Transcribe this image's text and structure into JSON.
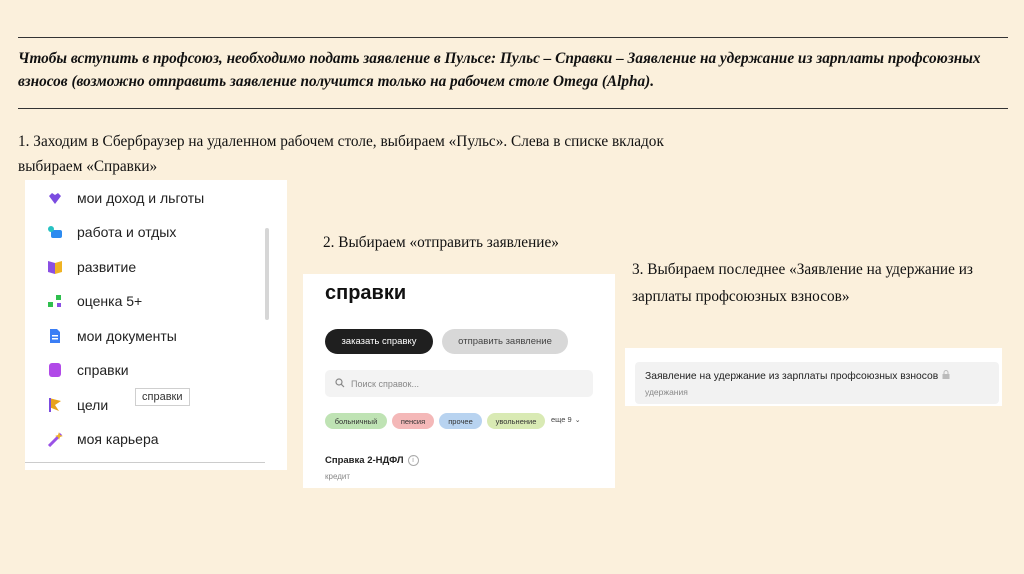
{
  "intro": "Чтобы вступить в профсоюз, необходимо подать заявление в Пульсе: Пульс – Справки – Заявление на удержание из зарплаты профсоюзных взносов (возможно отправить заявление получится только на рабочем столе Omega (Alpha).",
  "steps": {
    "step1": "1. Заходим в Сбербраузер на удаленном рабочем столе, выбираем «Пульс». Слева в списке вкладок выбираем «Справки»",
    "step2": "2. Выбираем «отправить заявление»",
    "step3": "3. Выбираем последнее «Заявление на удержание из зарплаты профсоюзных взносов»"
  },
  "menu": {
    "items": [
      {
        "label": "мои доход и льготы",
        "icon": "heart-icon",
        "color": "#7b4ce0"
      },
      {
        "label": "работа и отдых",
        "icon": "palm-briefcase-icon",
        "color": "#2d8bf0"
      },
      {
        "label": "развитие",
        "icon": "book-icon",
        "color": "#8a4fe3"
      },
      {
        "label": "оценка 5+",
        "icon": "sparkle-icon",
        "color": "#2fbf4e"
      },
      {
        "label": "мои документы",
        "icon": "document-icon",
        "color": "#3b7ef5"
      },
      {
        "label": "справки",
        "icon": "certificate-icon",
        "color": "#b149e8"
      },
      {
        "label": "цели",
        "icon": "flag-icon",
        "color": "#e8a21e"
      },
      {
        "label": "моя карьера",
        "icon": "star-wand-icon",
        "color": "#9a52e6"
      }
    ],
    "tooltip": "справки"
  },
  "panel2": {
    "title": "справки",
    "btn_order": "заказать справку",
    "btn_send": "отправить заявление",
    "search_placeholder": "Поиск справок...",
    "chips": [
      "больничный",
      "пенсия",
      "прочее",
      "увольнение"
    ],
    "more": "еще 9",
    "cert_title": "Справка 2-НДФЛ",
    "cert_sub": "кредит"
  },
  "panel3": {
    "item_title": "Заявление на удержание из зарплаты профсоюзных взносов",
    "item_sub": "удержания"
  }
}
